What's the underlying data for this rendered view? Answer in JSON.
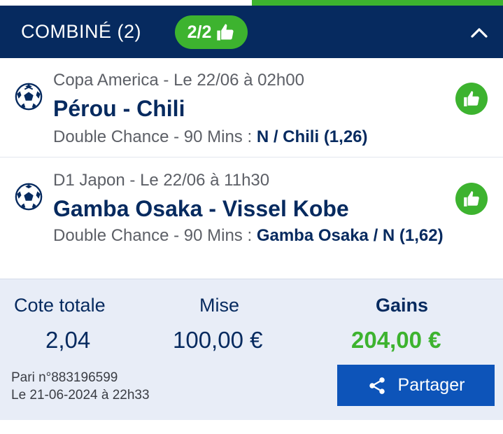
{
  "header": {
    "title": "COMBINÉ (2)",
    "badge": "2/2",
    "badge_icon": "thumbs-up-icon",
    "toggle_icon": "chevron-up-icon"
  },
  "bets": [
    {
      "sport_icon": "soccer-ball-icon",
      "meta": "Copa America - Le 22/06 à 02h00",
      "match": "Pérou - Chili",
      "market": "Double Chance - 90 Mins : ",
      "pick": "N / Chili (1,26)",
      "status_icon": "thumbs-up-icon"
    },
    {
      "sport_icon": "soccer-ball-icon",
      "meta": "D1 Japon - Le 22/06 à 11h30",
      "match": "Gamba Osaka - Vissel Kobe",
      "market": "Double Chance - 90 Mins : ",
      "pick": "Gamba Osaka / N (1,62)",
      "status_icon": "thumbs-up-icon"
    }
  ],
  "summary": {
    "cote_label": "Cote totale",
    "cote_value": "2,04",
    "mise_label": "Mise",
    "mise_value": "100,00 €",
    "gains_label": "Gains",
    "gains_value": "204,00 €",
    "pari": "Pari n°883196599",
    "date": "Le 21-06-2024 à 22h33",
    "share_label": "Partager",
    "share_icon": "share-icon"
  },
  "colors": {
    "navy": "#062a5f",
    "green": "#3db32f",
    "blue_button": "#0d54b9",
    "summary_bg": "#e8edf7"
  }
}
